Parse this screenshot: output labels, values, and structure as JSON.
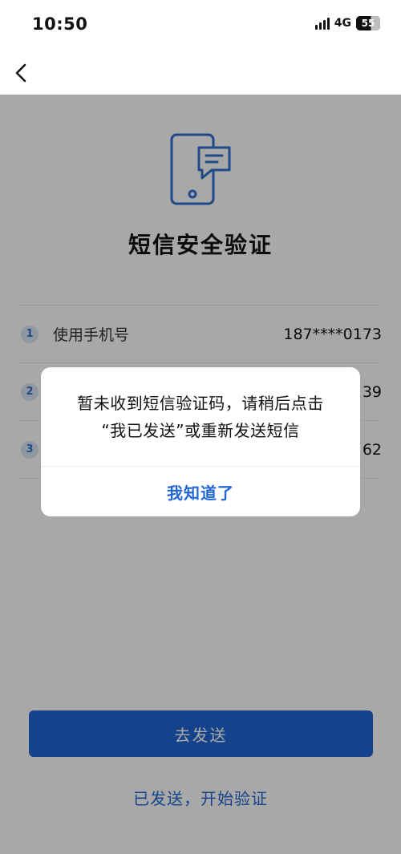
{
  "status_bar": {
    "time": "10:50",
    "network": "4G",
    "battery": "55"
  },
  "nav": {
    "back_icon": "chevron-left-icon"
  },
  "page": {
    "hero_icon": "phone-message-icon",
    "title": "短信安全验证",
    "steps": [
      {
        "num": "1",
        "label": "使用手机号",
        "value": "187****0173"
      },
      {
        "num": "2",
        "label": "",
        "value": "39"
      },
      {
        "num": "3",
        "label": "",
        "value": "62"
      }
    ],
    "primary_button": "去发送",
    "secondary_link": "已发送，开始验证"
  },
  "dialog": {
    "message_line1": "暂未收到短信验证码，请稍后点击",
    "message_line2": "“我已发送”或重新发送短信",
    "confirm": "我知道了"
  },
  "colors": {
    "accent": "#2167d4",
    "overlay": "rgba(0,0,0,0.34)"
  }
}
